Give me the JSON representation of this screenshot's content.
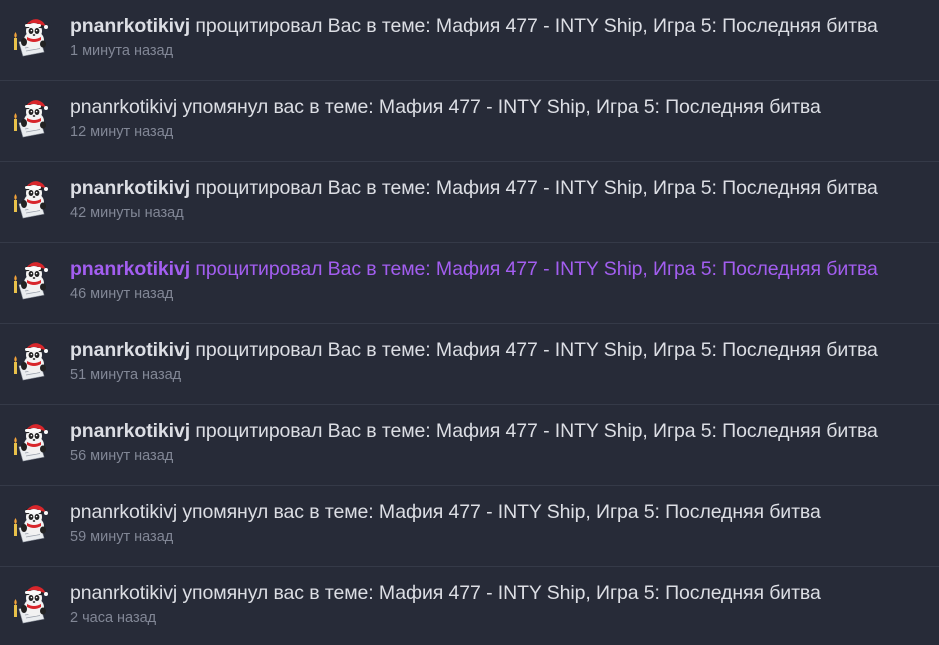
{
  "avatar_icon": "panda-santa-avatar-icon",
  "colors": {
    "background": "#272b38",
    "text": "#dcdee4",
    "time": "#828796",
    "highlight": "#a35ef0",
    "divider": "#353a48"
  },
  "notifications": [
    {
      "user": "pnanrkotikivj",
      "action": " процитировал Вас в теме: Мафия 477 - INTY Ship, Игра 5: Последняя битва",
      "time": "1 минута назад"
    },
    {
      "user": "pnanrkotikivj",
      "action": " упомянул вас в теме: Мафия 477 - INTY Ship, Игра 5: Последняя битва",
      "time": "12 минут назад"
    },
    {
      "user": "pnanrkotikivj",
      "action": " процитировал Вас в теме: Мафия 477 - INTY Ship, Игра 5: Последняя битва",
      "time": "42 минуты назад"
    },
    {
      "user": "pnanrkotikivj",
      "action": " процитировал Вас в теме: Мафия 477 - INTY Ship, Игра 5: Последняя битва",
      "time": "46 минут назад"
    },
    {
      "user": "pnanrkotikivj",
      "action": " процитировал Вас в теме: Мафия 477 - INTY Ship, Игра 5: Последняя битва",
      "time": "51 минута назад"
    },
    {
      "user": "pnanrkotikivj",
      "action": " процитировал Вас в теме: Мафия 477 - INTY Ship, Игра 5: Последняя битва",
      "time": "56 минут назад"
    },
    {
      "user": "pnanrkotikivj",
      "action": " упомянул вас в теме: Мафия 477 - INTY Ship, Игра 5: Последняя битва",
      "time": "59 минут назад"
    },
    {
      "user": "pnanrkotikivj",
      "action": " упомянул вас в теме: Мафия 477 - INTY Ship, Игра 5: Последняя битва",
      "time": "2 часа назад"
    }
  ]
}
